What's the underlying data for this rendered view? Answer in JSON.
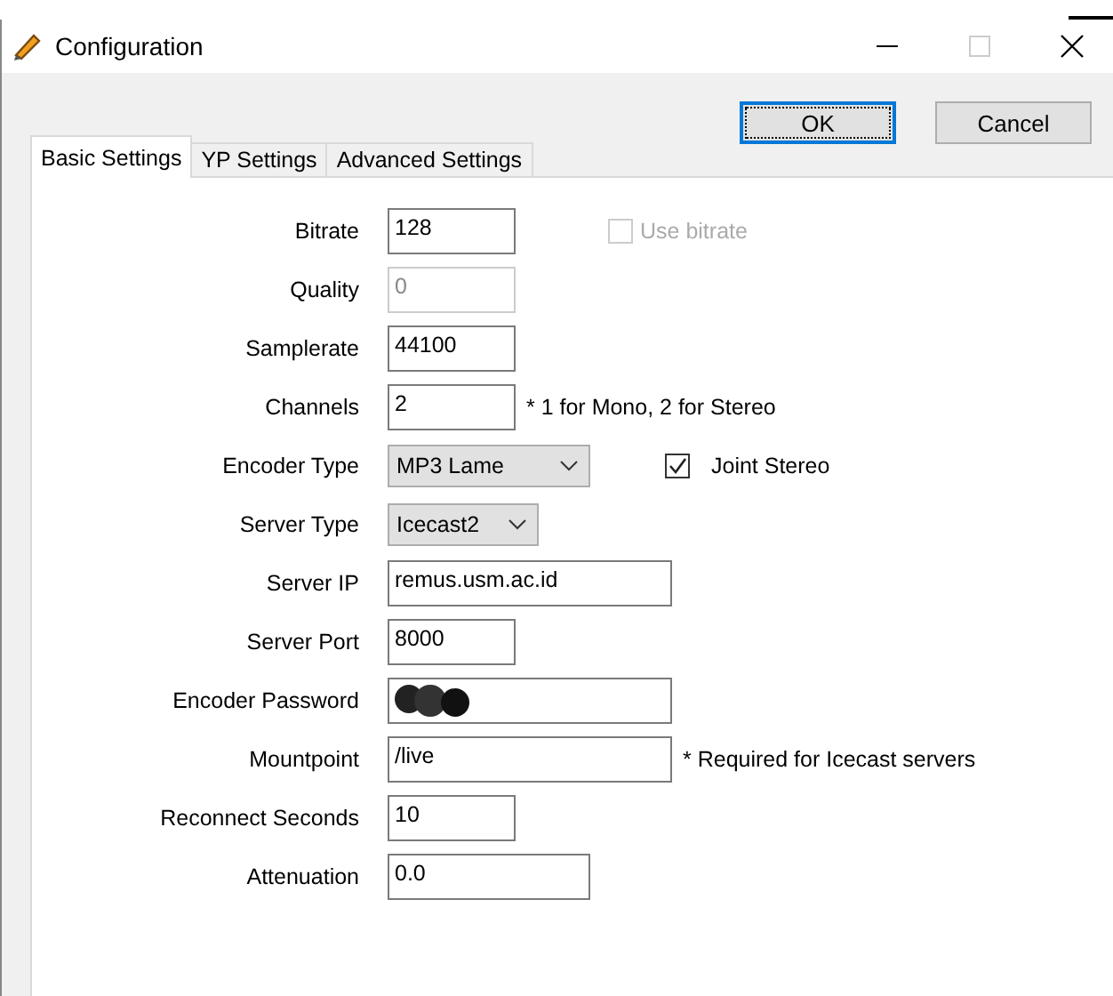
{
  "window": {
    "title": "Configuration",
    "maximize_disabled": true
  },
  "buttons": [
    {
      "label": "OK",
      "default": true
    },
    {
      "label": "Cancel",
      "default": false
    }
  ],
  "tabs": [
    {
      "label": "Basic Settings",
      "selected": true
    },
    {
      "label": "YP Settings",
      "selected": false
    },
    {
      "label": "Advanced Settings",
      "selected": false
    }
  ],
  "fields": [
    {
      "label": "Bitrate",
      "kind": "text",
      "value": "128",
      "disabled": false,
      "extra": {
        "kind": "checkbox",
        "label": "Use bitrate",
        "checked": false,
        "disabled": true
      }
    },
    {
      "label": "Quality",
      "kind": "text",
      "value": "0",
      "disabled": true
    },
    {
      "label": "Samplerate",
      "kind": "text",
      "value": "44100",
      "disabled": false
    },
    {
      "label": "Channels",
      "kind": "text",
      "value": "2",
      "disabled": false,
      "extra": {
        "kind": "note",
        "label": "* 1 for Mono, 2 for Stereo"
      }
    },
    {
      "label": "Encoder Type",
      "kind": "dropdown",
      "value": "MP3 Lame",
      "disabled": false,
      "extra": {
        "kind": "checkbox",
        "label": "Joint Stereo",
        "checked": true,
        "disabled": false
      }
    },
    {
      "label": "Server Type",
      "kind": "dropdown",
      "value": "Icecast2",
      "disabled": false
    },
    {
      "label": "Server IP",
      "kind": "text",
      "value": "remus.usm.ac.id",
      "disabled": false
    },
    {
      "label": "Server Port",
      "kind": "text",
      "value": "8000",
      "disabled": false
    },
    {
      "label": "Encoder Password",
      "kind": "redacted",
      "disabled": false
    },
    {
      "label": "Mountpoint",
      "kind": "text",
      "value": "/live",
      "disabled": false,
      "extra": {
        "kind": "note",
        "label": "* Required for Icecast servers"
      }
    },
    {
      "label": "Reconnect Seconds",
      "kind": "text",
      "value": "10",
      "disabled": false
    },
    {
      "label": "Attenuation",
      "kind": "text",
      "value": "0.0",
      "disabled": false
    }
  ]
}
